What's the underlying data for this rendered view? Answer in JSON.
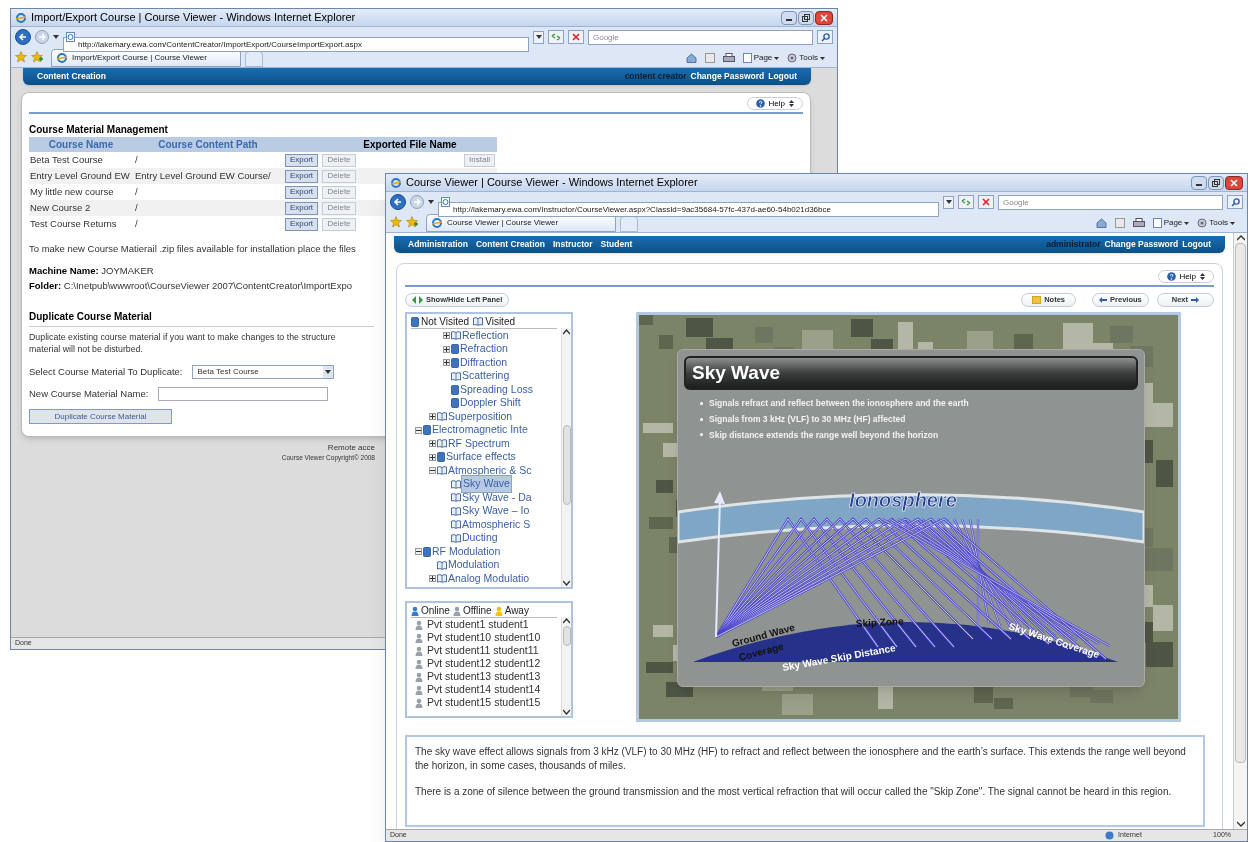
{
  "back_window": {
    "title": "Import/Export Course | Course Viewer - Windows Internet Explorer",
    "address": "http://lakemary.ewa.com/ContentCreator/ImportExport/CourseImportExport.aspx",
    "search": {
      "placeholder": "Google"
    },
    "tab": "Import/Export Course | Course Viewer",
    "toolbar": [
      "Page",
      "Tools"
    ],
    "nav": {
      "links": [
        "Content Creation"
      ],
      "user": "content creator",
      "account_links": [
        "Change Password",
        "Logout"
      ]
    },
    "help": "Help",
    "section_title": "Course Material Management",
    "table": {
      "columns": [
        "Course Name",
        "Course Content Path",
        "Exported File Name"
      ],
      "rows": [
        {
          "name": "Beta Test Course",
          "path": "/",
          "export": {
            "label": "Export",
            "disabled": false
          },
          "delete": {
            "label": "Delete",
            "disabled": true
          },
          "install": {
            "label": "Install",
            "disabled": true
          }
        },
        {
          "name": "Entry Level Ground EW",
          "path": "Entry Level Ground EW Course/",
          "export": {
            "label": "Export",
            "disabled": false
          },
          "delete": {
            "label": "Delete",
            "disabled": true
          }
        },
        {
          "name": "My little new course",
          "path": "/",
          "export": {
            "label": "Export",
            "disabled": false
          },
          "delete": {
            "label": "Delete",
            "disabled": true
          }
        },
        {
          "name": "New Course 2",
          "path": "/",
          "export": {
            "label": "Export",
            "disabled": false
          },
          "delete": {
            "label": "Delete",
            "disabled": true
          }
        },
        {
          "name": "Test Course Returns",
          "path": "/",
          "export": {
            "label": "Export",
            "disabled": false
          },
          "delete": {
            "label": "Delete",
            "disabled": true
          }
        }
      ]
    },
    "note": "To make new Course Matierail .zip files available for installation place the files",
    "machine": {
      "label": "Machine Name:",
      "value": "JOYMAKER"
    },
    "folder": {
      "label": "Folder:",
      "value": "C:\\Inetpub\\wwwroot\\CourseViewer 2007\\ContentCreator\\ImportExpo"
    },
    "duplicate": {
      "title": "Duplicate Course Material",
      "text_lines": [
        "Duplicate existing course material if you want to make changes to the structure",
        "material will not be disturbed."
      ],
      "select_label": "Select Course Material To Duplicate:",
      "select_value": "Beta Test Course",
      "name_label": "New Course Material Name:",
      "button": "Duplicate Course Material"
    },
    "footer": [
      "Remote acce",
      "Course Viewer Copyright© 2008"
    ],
    "status_bar": {
      "text": "Done"
    }
  },
  "front_window": {
    "title": "Course Viewer | Course Viewer - Windows Internet Explorer",
    "address": "http://lakemary.ewa.com/Instructor/CourseViewer.aspx?ClassId=9ac35684-57fc-437d-ae60-54b021d36bce",
    "search": {
      "placeholder": "Google"
    },
    "tab": "Course Viewer | Course Viewer",
    "toolbar": [
      "Page",
      "Tools"
    ],
    "nav": {
      "links": [
        "Administration",
        "Content Creation",
        "Instructor",
        "Student"
      ],
      "user": "administrator",
      "account_links": [
        "Change Password",
        "Logout"
      ]
    },
    "help": "Help",
    "panel_toggle": "Show/Hide Left Panel",
    "notes": "Notes",
    "previous": "Previous",
    "next": "Next",
    "tree": {
      "legend": [
        {
          "label": "Not Visited",
          "visited": false
        },
        {
          "label": "Visited",
          "visited": true
        }
      ],
      "items": [
        {
          "children": [
            {
              "children": [
                {
                  "label": "Reflection",
                  "visited": true,
                  "expanded": false,
                  "selected": false
                },
                {
                  "label": "Refraction",
                  "visited": false,
                  "expanded": false,
                  "selected": false
                },
                {
                  "label": "Diffraction",
                  "visited": false,
                  "expanded": false,
                  "selected": false
                },
                {
                  "label": "Scattering",
                  "visited": true,
                  "selected": false
                },
                {
                  "label": "Spreading Loss",
                  "visited": false,
                  "selected": false
                },
                {
                  "label": "Doppler Shift",
                  "visited": false,
                  "selected": false
                }
              ]
            },
            {
              "label": "Superposition",
              "visited": true,
              "expanded": false,
              "selected": false
            }
          ]
        },
        {
          "label": "Electromagnetic Inte",
          "visited": false,
          "expanded": true,
          "selected": false,
          "children": [
            {
              "label": "RF Spectrum",
              "visited": true,
              "expanded": false,
              "selected": false
            },
            {
              "label": "Surface effects",
              "visited": false,
              "expanded": false,
              "selected": false
            },
            {
              "label": "Atmospheric & Sc",
              "visited": true,
              "expanded": true,
              "selected": false,
              "children": [
                {
                  "label": "Sky Wave",
                  "visited": true,
                  "selected": true
                },
                {
                  "label": "Sky Wave - Da",
                  "visited": true,
                  "selected": false
                },
                {
                  "label": "Sky Wave – Io",
                  "visited": true,
                  "selected": false
                },
                {
                  "label": "Atmospheric S",
                  "visited": true,
                  "selected": false
                },
                {
                  "label": "Ducting",
                  "visited": true,
                  "selected": false
                }
              ]
            }
          ]
        },
        {
          "label": "RF Modulation",
          "visited": false,
          "expanded": true,
          "selected": false,
          "children": [
            {
              "label": "Modulation",
              "visited": true,
              "selected": false
            },
            {
              "label": "Analog Modulatio",
              "visited": true,
              "expanded": false,
              "selected": false
            }
          ]
        }
      ]
    },
    "presence": {
      "legend": [
        {
          "label": "Online",
          "color": "#2f7fd6"
        },
        {
          "label": "Offline",
          "color": "#9aa0a8"
        },
        {
          "label": "Away",
          "color": "#f2c200"
        }
      ],
      "students": [
        {
          "name": "Pvt student1 student1",
          "color": "#9aa0a8"
        },
        {
          "name": "Pvt student10 student10",
          "color": "#9aa0a8"
        },
        {
          "name": "Pvt student11 student11",
          "color": "#9aa0a8"
        },
        {
          "name": "Pvt student12 student12",
          "color": "#9aa0a8"
        },
        {
          "name": "Pvt student13 student13",
          "color": "#9aa0a8"
        },
        {
          "name": "Pvt student14 student14",
          "color": "#9aa0a8"
        },
        {
          "name": "Pvt student15 student15",
          "color": "#9aa0a8"
        }
      ]
    },
    "slide": {
      "title": "Sky Wave",
      "bullets": [
        "Signals refract and reflect between the ionosphere and the earth",
        "Signals from 3 kHz (VLF) to 30 MHz (HF) affected",
        "Skip distance extends the range well beyond the horizon"
      ],
      "diagram_labels": [
        "Ionosphere",
        "Ground Wave",
        "Coverage",
        "Skip Zone",
        "Sky Wave Skip Distance",
        "Sky Wave Coverage"
      ]
    },
    "description": [
      "The sky wave effect allows signals from 3 kHz (VLF) to 30 MHz (HF) to refract and reflect between the ionosphere and the earth’s surface. This extends the range well beyond the horizon, in some cases, thousands of miles.",
      "There is a zone of silence between the ground transmission and the most vertical refraction that will occur called the \"Skip Zone\". The signal cannot be heard in this region."
    ],
    "status_bar": {
      "text": "Done",
      "zone": "Internet",
      "zoom": "100%"
    }
  }
}
